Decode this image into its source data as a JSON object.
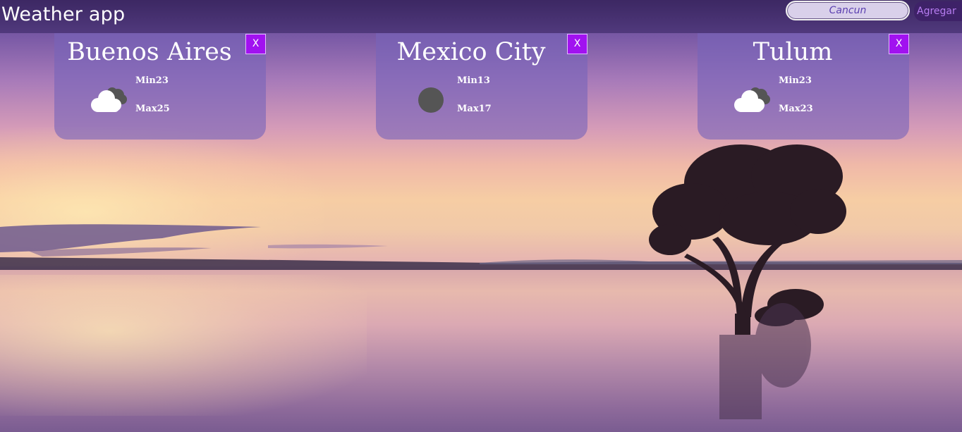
{
  "header": {
    "title": "Weather app",
    "search_value": "Cancun",
    "add_label": "Agregar"
  },
  "cards": [
    {
      "city": "Buenos Aires",
      "close_label": "X",
      "icon": "cloudy-icon",
      "min": "Min23",
      "max": "Max25"
    },
    {
      "city": "Mexico City",
      "close_label": "X",
      "icon": "dark-circle-icon",
      "min": "Min13",
      "max": "Max17"
    },
    {
      "city": "Tulum",
      "close_label": "X",
      "icon": "cloudy-icon",
      "min": "Min23",
      "max": "Max23"
    }
  ],
  "colors": {
    "close_button": "#a112f0",
    "add_button_bg": "#3e2268",
    "add_button_text": "#b67cf0",
    "card_bg": "rgba(120,100,185,0.62)"
  }
}
